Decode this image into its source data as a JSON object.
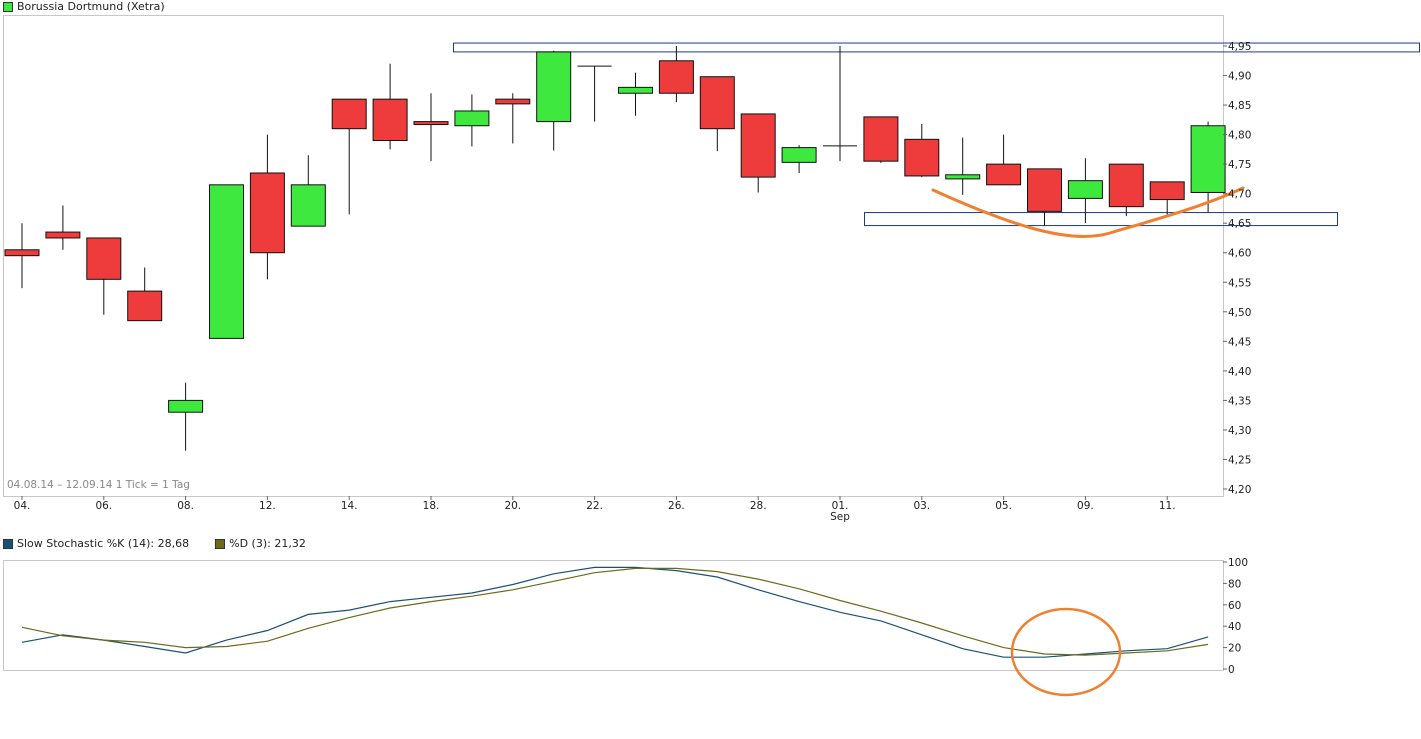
{
  "header": {
    "title": "Borussia Dortmund (Xetra)",
    "title_color": "#3ee83e"
  },
  "range_label": "04.08.14 – 12.09.14   1 Tick = 1 Tag",
  "stoch_legend": {
    "k_label": "Slow Stochastic %K (14): 28,68",
    "k_color": "#1a5276",
    "d_label": "%D (3): 21,32",
    "d_color": "#6b6b1a"
  },
  "colors": {
    "up": "#3ee83e",
    "down": "#ee3b3b",
    "box": "#1a3a8a",
    "highlight": "#f08030"
  },
  "chart_data": [
    {
      "type": "candlestick",
      "title": "Borussia Dortmund (Xetra)",
      "ylim": [
        4.2,
        4.95
      ],
      "y_ticks": [
        "4,20",
        "4,25",
        "4,30",
        "4,35",
        "4,40",
        "4,45",
        "4,50",
        "4,55",
        "4,60",
        "4,65",
        "4,70",
        "4,75",
        "4,80",
        "4,85",
        "4,90",
        "4,95"
      ],
      "x_tick_labels": [
        "04.",
        "06.",
        "08.",
        "12.",
        "14.",
        "18.",
        "20.",
        "22.",
        "26.",
        "28.",
        "01.",
        "03.",
        "05.",
        "09.",
        "11."
      ],
      "x_sublabel": {
        "under": "01.",
        "text": "Sep"
      },
      "candles": [
        {
          "date": "04.08",
          "open": 4.605,
          "high": 4.65,
          "low": 4.54,
          "close": 4.595
        },
        {
          "date": "05.08",
          "open": 4.635,
          "high": 4.68,
          "low": 4.605,
          "close": 4.625
        },
        {
          "date": "06.08",
          "open": 4.625,
          "high": 4.625,
          "low": 4.495,
          "close": 4.555
        },
        {
          "date": "07.08",
          "open": 4.535,
          "high": 4.575,
          "low": 4.485,
          "close": 4.485
        },
        {
          "date": "08.08",
          "open": 4.33,
          "high": 4.38,
          "low": 4.265,
          "close": 4.35
        },
        {
          "date": "11.08",
          "open": 4.455,
          "high": 4.715,
          "low": 4.455,
          "close": 4.715
        },
        {
          "date": "12.08",
          "open": 4.735,
          "high": 4.8,
          "low": 4.555,
          "close": 4.6
        },
        {
          "date": "13.08",
          "open": 4.645,
          "high": 4.765,
          "low": 4.645,
          "close": 4.715
        },
        {
          "date": "14.08",
          "open": 4.86,
          "high": 4.86,
          "low": 4.665,
          "close": 4.81
        },
        {
          "date": "15.08",
          "open": 4.86,
          "high": 4.92,
          "low": 4.775,
          "close": 4.79
        },
        {
          "date": "18.08",
          "open": 4.822,
          "high": 4.87,
          "low": 4.755,
          "close": 4.817
        },
        {
          "date": "19.08",
          "open": 4.815,
          "high": 4.868,
          "low": 4.78,
          "close": 4.84
        },
        {
          "date": "20.08",
          "open": 4.86,
          "high": 4.87,
          "low": 4.785,
          "close": 4.852
        },
        {
          "date": "21.08",
          "open": 4.822,
          "high": 4.942,
          "low": 4.773,
          "close": 4.94
        },
        {
          "date": "22.08",
          "open": 4.916,
          "high": 4.916,
          "low": 4.822,
          "close": 4.916
        },
        {
          "date": "25.08",
          "open": 4.87,
          "high": 4.905,
          "low": 4.832,
          "close": 4.88
        },
        {
          "date": "26.08",
          "open": 4.925,
          "high": 4.95,
          "low": 4.855,
          "close": 4.87
        },
        {
          "date": "27.08",
          "open": 4.898,
          "high": 4.898,
          "low": 4.772,
          "close": 4.81
        },
        {
          "date": "28.08",
          "open": 4.835,
          "high": 4.835,
          "low": 4.702,
          "close": 4.728
        },
        {
          "date": "29.08",
          "open": 4.753,
          "high": 4.782,
          "low": 4.735,
          "close": 4.778
        },
        {
          "date": "01.09",
          "open": 4.781,
          "high": 4.95,
          "low": 4.755,
          "close": 4.781
        },
        {
          "date": "02.09",
          "open": 4.83,
          "high": 4.83,
          "low": 4.752,
          "close": 4.755
        },
        {
          "date": "03.09",
          "open": 4.792,
          "high": 4.818,
          "low": 4.728,
          "close": 4.73
        },
        {
          "date": "04.09",
          "open": 4.725,
          "high": 4.795,
          "low": 4.698,
          "close": 4.732
        },
        {
          "date": "05.09",
          "open": 4.75,
          "high": 4.8,
          "low": 4.715,
          "close": 4.715
        },
        {
          "date": "08.09",
          "open": 4.742,
          "high": 4.742,
          "low": 4.645,
          "close": 4.67
        },
        {
          "date": "09.09",
          "open": 4.692,
          "high": 4.76,
          "low": 4.65,
          "close": 4.722
        },
        {
          "date": "10.09",
          "open": 4.75,
          "high": 4.75,
          "low": 4.662,
          "close": 4.678
        },
        {
          "date": "11.09",
          "open": 4.72,
          "high": 4.72,
          "low": 4.665,
          "close": 4.69
        },
        {
          "date": "12.09",
          "open": 4.702,
          "high": 4.822,
          "low": 4.668,
          "close": 4.815
        }
      ],
      "resistance_zone": [
        4.94,
        4.955
      ],
      "support_zone": [
        4.646,
        4.668
      ]
    },
    {
      "type": "line",
      "ylim": [
        0,
        100
      ],
      "y_ticks": [
        "0",
        "20",
        "40",
        "60",
        "80",
        "100"
      ],
      "series": [
        {
          "name": "Slow Stochastic %K (14): 28,68",
          "values": [
            25,
            32,
            27,
            21,
            15,
            27,
            36,
            51,
            55,
            63,
            67,
            71,
            79,
            89,
            95,
            95,
            92,
            86,
            74,
            63,
            53,
            45,
            32,
            19,
            11,
            11,
            14,
            17,
            19,
            30
          ]
        },
        {
          "name": "%D (3): 21,32",
          "values": [
            39,
            31,
            27,
            25,
            20,
            21,
            26,
            38,
            48,
            57,
            63,
            68,
            74,
            82,
            90,
            94,
            94,
            91,
            84,
            75,
            64,
            54,
            43,
            31,
            20,
            14,
            13,
            15,
            17,
            23
          ]
        }
      ]
    }
  ]
}
